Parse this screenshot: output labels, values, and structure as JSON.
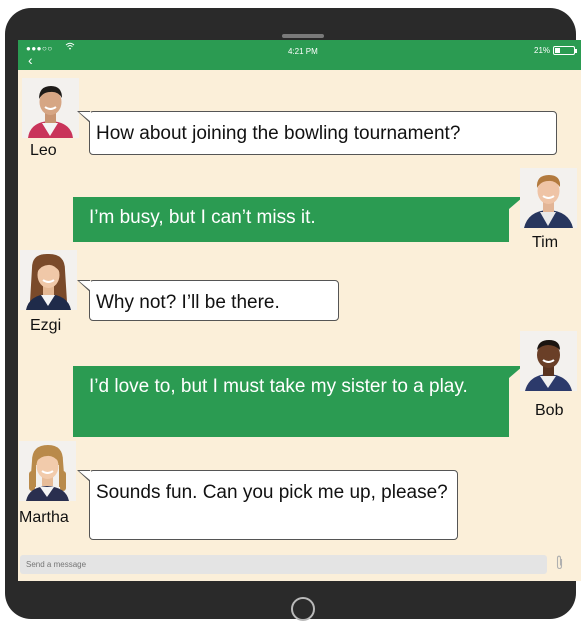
{
  "status_bar": {
    "signal": "●●●○○",
    "time": "4:21 PM",
    "battery": "21%",
    "color": "#2b9b52"
  },
  "messages": [
    {
      "sender": "Leo",
      "text": "How about joining the bowling tournament?",
      "side": "left"
    },
    {
      "sender": "Tim",
      "text": "I’m busy, but I can’t miss it.",
      "side": "right"
    },
    {
      "sender": "Ezgi",
      "text": "Why not? I’ll be there.",
      "side": "left"
    },
    {
      "sender": "Bob",
      "text": "I’d love to, but I must take my sister to a play.",
      "side": "right"
    },
    {
      "sender": "Martha",
      "text": "Sounds fun. Can you pick me up, please?",
      "side": "left"
    }
  ],
  "composer": {
    "placeholder": "Send a message",
    "attach_icon": "paperclip-icon"
  },
  "colors": {
    "chat_background": "#fbefd9",
    "green_bubble": "#2b9b52",
    "device_frame": "#2a2a2a"
  }
}
